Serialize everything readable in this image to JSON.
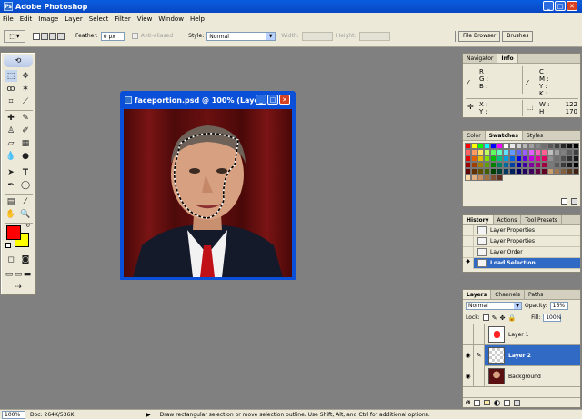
{
  "app": {
    "title": "Adobe Photoshop"
  },
  "menu": [
    "File",
    "Edit",
    "Image",
    "Layer",
    "Select",
    "Filter",
    "View",
    "Window",
    "Help"
  ],
  "options": {
    "feather_label": "Feather:",
    "feather_value": "0 px",
    "antialiased_label": "Anti-aliased",
    "style_label": "Style:",
    "style_value": "Normal",
    "width_label": "Width:",
    "height_label": "Height:",
    "file_browser": "File Browser",
    "brushes": "Brushes"
  },
  "document": {
    "title": "faceportion.psd @ 100% (Laye..."
  },
  "info": {
    "tabs": [
      "Navigator",
      "Info"
    ],
    "rgb": [
      "R :",
      "G :",
      "B :"
    ],
    "cmyk": [
      "C :",
      "M :",
      "Y :",
      "K :"
    ],
    "xy": [
      "X :",
      "Y :"
    ],
    "wh": [
      "W :",
      "H :"
    ],
    "w_value": "122",
    "h_value": "170"
  },
  "swatches": {
    "tabs": [
      "Color",
      "Swatches",
      "Styles"
    ],
    "colors": [
      "#ff0000",
      "#ffff00",
      "#00ff00",
      "#00ffff",
      "#0000ff",
      "#ff00ff",
      "#ffffff",
      "#e8e8e8",
      "#d0d0d0",
      "#b8b8b8",
      "#a0a0a0",
      "#888888",
      "#707070",
      "#585858",
      "#404040",
      "#282828",
      "#101010",
      "#000000",
      "#ff6060",
      "#ff9a60",
      "#ffe060",
      "#c0ff60",
      "#60ff60",
      "#60ffc0",
      "#60e0ff",
      "#609aff",
      "#6060ff",
      "#9a60ff",
      "#e060ff",
      "#ff60c0",
      "#ff6090",
      "#c0c0c0",
      "#a0a0a0",
      "#808080",
      "#606060",
      "#404040",
      "#e00000",
      "#e06000",
      "#e0c000",
      "#80e000",
      "#00c000",
      "#00c080",
      "#00a0e0",
      "#0060e0",
      "#0000e0",
      "#6000e0",
      "#c000e0",
      "#e000a0",
      "#e00060",
      "#909090",
      "#707070",
      "#505050",
      "#303030",
      "#181818",
      "#a00000",
      "#a04000",
      "#a08000",
      "#60a000",
      "#008000",
      "#008060",
      "#006aa0",
      "#0040a0",
      "#0000a0",
      "#4000a0",
      "#8000a0",
      "#a00070",
      "#a00040",
      "#7a7a7a",
      "#5a5a5a",
      "#3a3a3a",
      "#1a1a1a",
      "#000000",
      "#600000",
      "#603000",
      "#605000",
      "#406000",
      "#004000",
      "#004030",
      "#003a60",
      "#002060",
      "#000060",
      "#200060",
      "#400060",
      "#600040",
      "#600020",
      "#c8a070",
      "#a07850",
      "#806040",
      "#604020",
      "#402010",
      "#ffd8a8",
      "#e0b080",
      "#c89060",
      "#a07040",
      "#805030",
      "#603020"
    ]
  },
  "history": {
    "tabs": [
      "History",
      "Actions",
      "Tool Presets"
    ],
    "items": [
      "Layer Properties",
      "Layer Properties",
      "Layer Order",
      "Load Selection"
    ],
    "selected": 3
  },
  "layers": {
    "tabs": [
      "Layers",
      "Channels",
      "Paths"
    ],
    "blend_mode": "Normal",
    "opacity_label": "Opacity:",
    "opacity_value": "16%",
    "lock_label": "Lock:",
    "fill_label": "Fill:",
    "fill_value": "100%",
    "items": [
      "Layer 1",
      "Layer 2",
      "Background"
    ],
    "selected": 1
  },
  "status": {
    "zoom": "100%",
    "doc": "Doc: 264K/536K",
    "hint": "Draw rectangular selection or move selection outline.  Use Shift, Alt, and Ctrl for additional options."
  },
  "colors": {
    "foreground": "#ff0000",
    "background": "#ffff00",
    "accent": "#0a4fd8",
    "selection": "#316ac5"
  }
}
